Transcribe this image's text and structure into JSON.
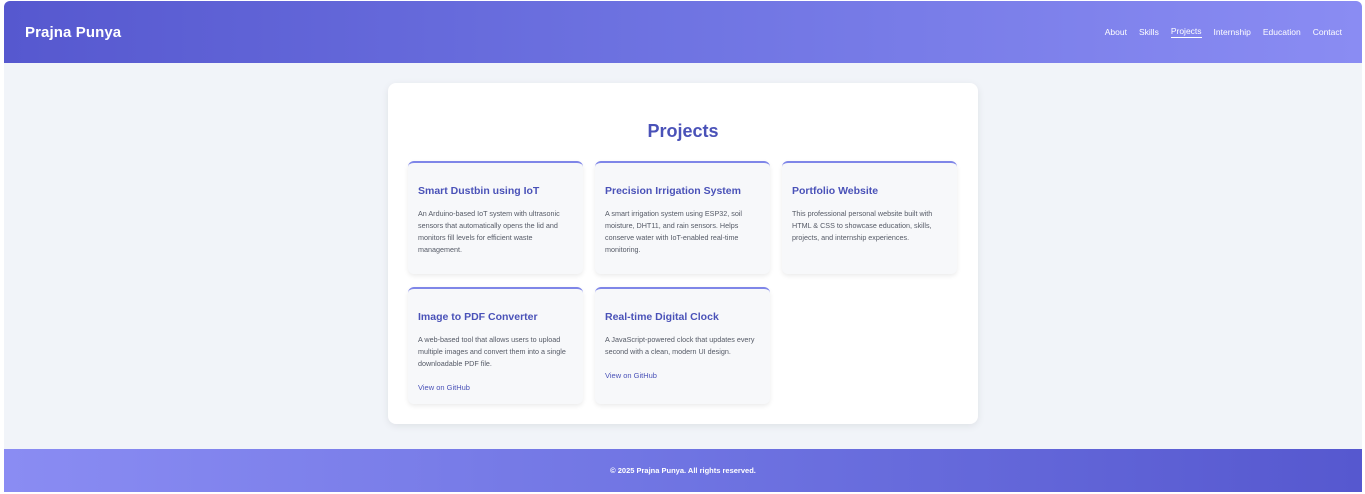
{
  "header": {
    "brand": "Prajna Punya",
    "nav": [
      {
        "label": "About",
        "active": false
      },
      {
        "label": "Skills",
        "active": false
      },
      {
        "label": "Projects",
        "active": true
      },
      {
        "label": "Internship",
        "active": false
      },
      {
        "label": "Education",
        "active": false
      },
      {
        "label": "Contact",
        "active": false
      }
    ]
  },
  "main": {
    "title": "Projects",
    "projects": [
      {
        "title": "Smart Dustbin using IoT",
        "description": "An Arduino-based IoT system with ultrasonic sensors that automatically opens the lid and monitors fill levels for efficient waste management.",
        "link": ""
      },
      {
        "title": "Precision Irrigation System",
        "description": "A smart irrigation system using ESP32, soil moisture, DHT11, and rain sensors. Helps conserve water with IoT-enabled real-time monitoring.",
        "link": ""
      },
      {
        "title": "Portfolio Website",
        "description": "This professional personal website built with HTML & CSS to showcase education, skills, projects, and internship experiences.",
        "link": ""
      },
      {
        "title": "Image to PDF Converter",
        "description": "A web-based tool that allows users to upload multiple images and convert them into a single downloadable PDF file.",
        "link": "View on GitHub"
      },
      {
        "title": "Real-time Digital Clock",
        "description": "A JavaScript-powered clock that updates every second with a clean, modern UI design.",
        "link": "View on GitHub"
      }
    ]
  },
  "footer": {
    "text": "© 2025 Prajna Punya. All rights reserved."
  },
  "colors": {
    "accent": "#4a52b8",
    "header_gradient_start": "#5658cf",
    "header_gradient_end": "#8a8cf3",
    "card_border": "#7f86e8",
    "page_background": "#f1f4f9"
  }
}
